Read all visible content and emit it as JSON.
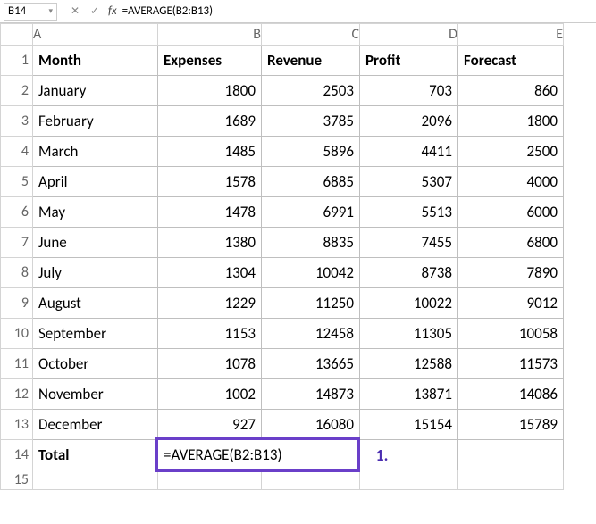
{
  "formula_bar": {
    "name_box": "B14",
    "cancel_icon": "✕",
    "enter_icon": "✓",
    "fx_label": "fx",
    "formula": "=AVERAGE(B2:B13)"
  },
  "columns": [
    "A",
    "B",
    "C",
    "D",
    "E"
  ],
  "row_numbers": [
    "1",
    "2",
    "3",
    "4",
    "5",
    "6",
    "7",
    "8",
    "9",
    "10",
    "11",
    "12",
    "13",
    "14",
    "15"
  ],
  "header": {
    "A": "Month",
    "B": "Expenses",
    "C": "Revenue",
    "D": "Profit",
    "E": "Forecast"
  },
  "rows": [
    {
      "A": "January",
      "B": "1800",
      "C": "2503",
      "D": "703",
      "E": "860"
    },
    {
      "A": "February",
      "B": "1689",
      "C": "3785",
      "D": "2096",
      "E": "1800"
    },
    {
      "A": "March",
      "B": "1485",
      "C": "5896",
      "D": "4411",
      "E": "2500"
    },
    {
      "A": "April",
      "B": "1578",
      "C": "6885",
      "D": "5307",
      "E": "4000"
    },
    {
      "A": "May",
      "B": "1478",
      "C": "6991",
      "D": "5513",
      "E": "6000"
    },
    {
      "A": "June",
      "B": "1380",
      "C": "8835",
      "D": "7455",
      "E": "6800"
    },
    {
      "A": "July",
      "B": "1304",
      "C": "10042",
      "D": "8738",
      "E": "7890"
    },
    {
      "A": "August",
      "B": "1229",
      "C": "11250",
      "D": "10022",
      "E": "9012"
    },
    {
      "A": "September",
      "B": "1153",
      "C": "12458",
      "D": "11305",
      "E": "10058"
    },
    {
      "A": "October",
      "B": "1078",
      "C": "13665",
      "D": "12588",
      "E": "11573"
    },
    {
      "A": "November",
      "B": "1002",
      "C": "14873",
      "D": "13871",
      "E": "14086"
    },
    {
      "A": "December",
      "B": "927",
      "C": "16080",
      "D": "15154",
      "E": "15789"
    }
  ],
  "total_row": {
    "A": "Total",
    "B": "=AVERAGE(B2:B13)",
    "C": "",
    "D": "",
    "E": ""
  },
  "annotation": "1."
}
